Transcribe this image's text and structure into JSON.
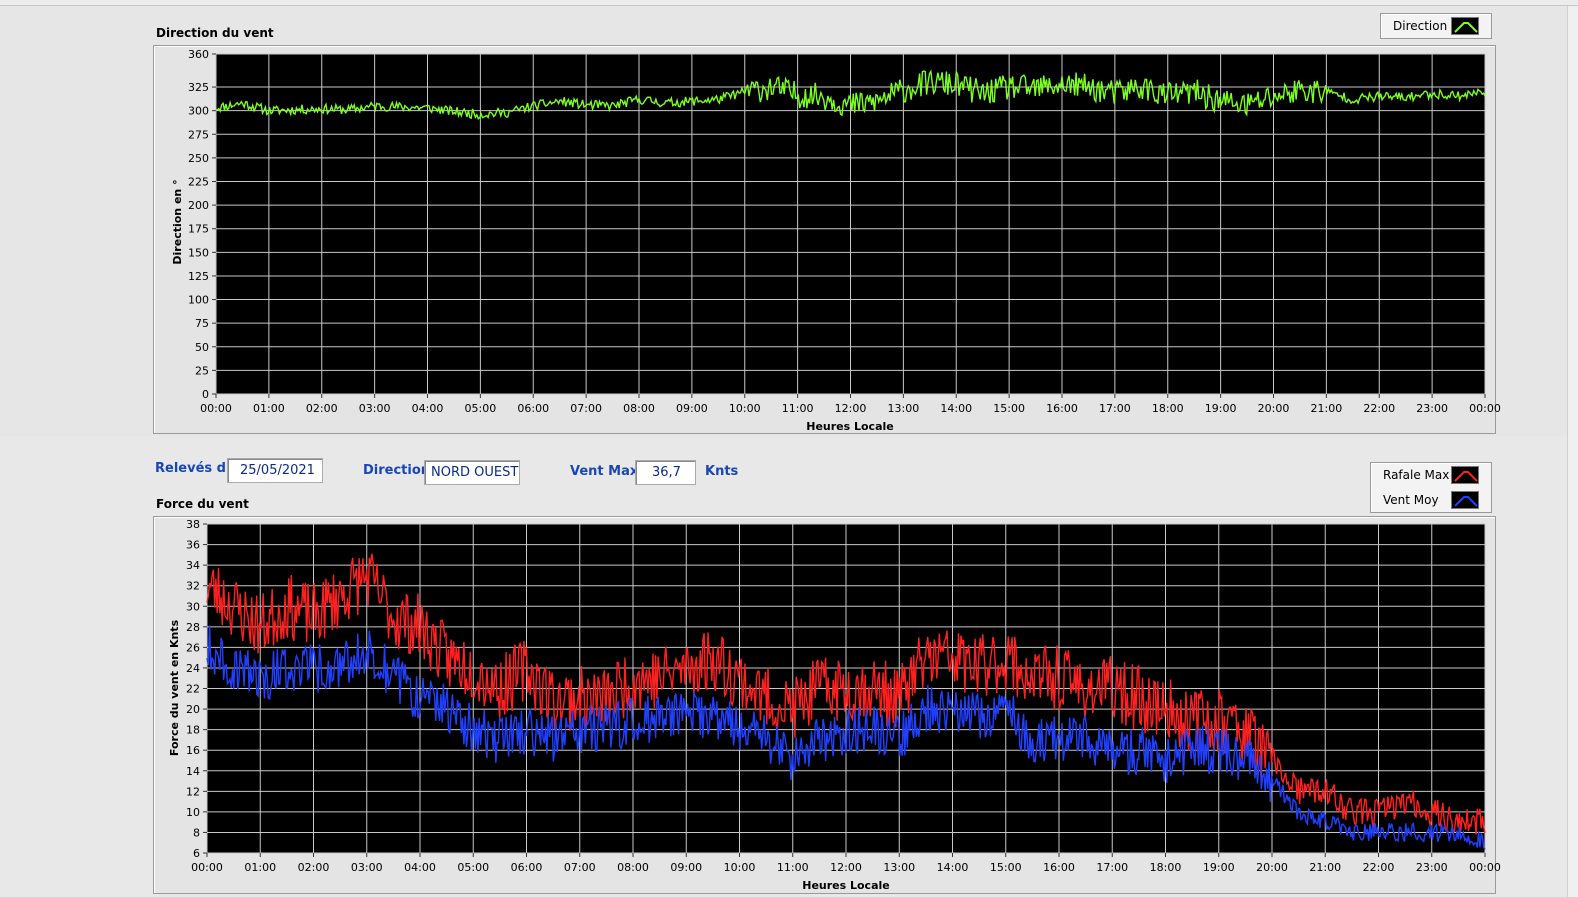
{
  "top_chart": {
    "title": "Direction du vent",
    "ylabel": "Direction en °",
    "xlabel": "Heures Locale",
    "legend": [
      {
        "name": "Direction",
        "color": "#7cff1f"
      }
    ]
  },
  "info": {
    "date_label": "Relevés du",
    "date_value": "25/05/2021",
    "direction_label": "Direction",
    "direction_value": "NORD OUEST",
    "vent_max_label": "Vent Max",
    "vent_max_value": "36,7",
    "unit": "Knts"
  },
  "bottom_chart": {
    "title": "Force du vent",
    "ylabel": "Force du vent en Knts",
    "xlabel": "Heures Locale",
    "legend": [
      {
        "name": "Rafale Max",
        "color": "#ff2020"
      },
      {
        "name": "Vent Moy",
        "color": "#2040ff"
      }
    ]
  },
  "chart_data": [
    {
      "type": "line",
      "title": "Direction du vent",
      "xlabel": "Heures Locale",
      "ylabel": "Direction en °",
      "x_ticks": [
        "00:00",
        "01:00",
        "02:00",
        "03:00",
        "04:00",
        "05:00",
        "06:00",
        "07:00",
        "08:00",
        "09:00",
        "10:00",
        "11:00",
        "12:00",
        "13:00",
        "14:00",
        "15:00",
        "16:00",
        "17:00",
        "18:00",
        "19:00",
        "20:00",
        "21:00",
        "22:00",
        "23:00",
        "00:00"
      ],
      "y_ticks": [
        "0",
        "25",
        "50",
        "75",
        "100",
        "125",
        "150",
        "175",
        "200",
        "225",
        "250",
        "275",
        "300",
        "325",
        "360"
      ],
      "ylim": [
        0,
        360
      ],
      "grid": true,
      "legend_position": "top-right",
      "series": [
        {
          "name": "Direction",
          "color": "#7cff1f",
          "x": [
            "00:00",
            "00:30",
            "01:00",
            "01:30",
            "02:00",
            "02:30",
            "03:00",
            "03:30",
            "04:00",
            "04:30",
            "05:00",
            "05:30",
            "06:00",
            "06:30",
            "07:00",
            "07:30",
            "08:00",
            "08:30",
            "09:00",
            "09:30",
            "10:00",
            "10:30",
            "11:00",
            "11:30",
            "12:00",
            "12:30",
            "13:00",
            "13:30",
            "14:00",
            "14:30",
            "15:00",
            "15:30",
            "16:00",
            "16:30",
            "17:00",
            "17:30",
            "18:00",
            "18:30",
            "19:00",
            "19:30",
            "20:00",
            "20:30",
            "21:00",
            "21:30",
            "22:00",
            "22:30",
            "23:00",
            "23:30",
            "00:00"
          ],
          "values": [
            303,
            308,
            300,
            301,
            302,
            301,
            305,
            304,
            303,
            299,
            296,
            298,
            305,
            310,
            306,
            305,
            312,
            308,
            310,
            312,
            320,
            325,
            317,
            315,
            305,
            310,
            322,
            330,
            328,
            318,
            325,
            323,
            328,
            325,
            318,
            325,
            316,
            320,
            310,
            306,
            315,
            322,
            320,
            312,
            315,
            314,
            318,
            316,
            320
          ]
        }
      ]
    },
    {
      "type": "line",
      "title": "Force du vent",
      "xlabel": "Heures Locale",
      "ylabel": "Force du vent en Knts",
      "x_ticks": [
        "00:00",
        "01:00",
        "02:00",
        "03:00",
        "04:00",
        "05:00",
        "06:00",
        "07:00",
        "08:00",
        "09:00",
        "10:00",
        "11:00",
        "12:00",
        "13:00",
        "14:00",
        "15:00",
        "16:00",
        "17:00",
        "18:00",
        "19:00",
        "20:00",
        "21:00",
        "22:00",
        "23:00",
        "00:00"
      ],
      "y_ticks": [
        "6",
        "8",
        "10",
        "12",
        "14",
        "16",
        "18",
        "20",
        "22",
        "24",
        "26",
        "28",
        "30",
        "32",
        "34",
        "36",
        "38"
      ],
      "ylim": [
        6,
        38
      ],
      "grid": true,
      "legend_position": "top-right",
      "series": [
        {
          "name": "Rafale Max",
          "color": "#ff2020",
          "x": [
            "00:00",
            "00:30",
            "01:00",
            "01:30",
            "02:00",
            "02:30",
            "03:00",
            "03:30",
            "04:00",
            "04:30",
            "05:00",
            "05:30",
            "06:00",
            "06:30",
            "07:00",
            "07:30",
            "08:00",
            "08:30",
            "09:00",
            "09:30",
            "10:00",
            "10:30",
            "11:00",
            "11:30",
            "12:00",
            "12:30",
            "13:00",
            "13:30",
            "14:00",
            "14:30",
            "15:00",
            "15:30",
            "16:00",
            "16:30",
            "17:00",
            "17:30",
            "18:00",
            "18:30",
            "19:00",
            "19:30",
            "20:00",
            "20:30",
            "21:00",
            "21:30",
            "22:00",
            "22:30",
            "23:00",
            "23:30",
            "00:00"
          ],
          "values": [
            32,
            30,
            28,
            30,
            29,
            31,
            33,
            29,
            28,
            25,
            24,
            22,
            24,
            21,
            21,
            21,
            23,
            23,
            24,
            25,
            23,
            21,
            20,
            22,
            22,
            22,
            21,
            25,
            25,
            24,
            25,
            23,
            23,
            22,
            22,
            21,
            20,
            19,
            19,
            18,
            15,
            12,
            12,
            10,
            10,
            11,
            10,
            9,
            9
          ]
        },
        {
          "name": "Vent Moy",
          "color": "#2040ff",
          "x": [
            "00:00",
            "00:30",
            "01:00",
            "01:30",
            "02:00",
            "02:30",
            "03:00",
            "03:30",
            "04:00",
            "04:30",
            "05:00",
            "05:30",
            "06:00",
            "06:30",
            "07:00",
            "07:30",
            "08:00",
            "08:30",
            "09:00",
            "09:30",
            "10:00",
            "10:30",
            "11:00",
            "11:30",
            "12:00",
            "12:30",
            "13:00",
            "13:30",
            "14:00",
            "14:30",
            "15:00",
            "15:30",
            "16:00",
            "16:30",
            "17:00",
            "17:30",
            "18:00",
            "18:30",
            "19:00",
            "19:30",
            "20:00",
            "20:30",
            "21:00",
            "21:30",
            "22:00",
            "22:30",
            "23:00",
            "23:30",
            "00:00"
          ],
          "values": [
            26,
            24,
            23,
            24,
            24,
            24,
            26,
            23,
            21,
            20,
            18,
            17,
            18,
            17,
            18,
            18,
            19,
            19,
            20,
            19,
            18,
            17,
            15,
            17,
            18,
            18,
            17,
            20,
            20,
            19,
            20,
            17,
            17,
            17,
            16,
            16,
            15,
            16,
            16,
            15,
            13,
            10,
            9,
            8,
            8,
            8,
            8,
            8,
            7
          ]
        }
      ]
    }
  ]
}
